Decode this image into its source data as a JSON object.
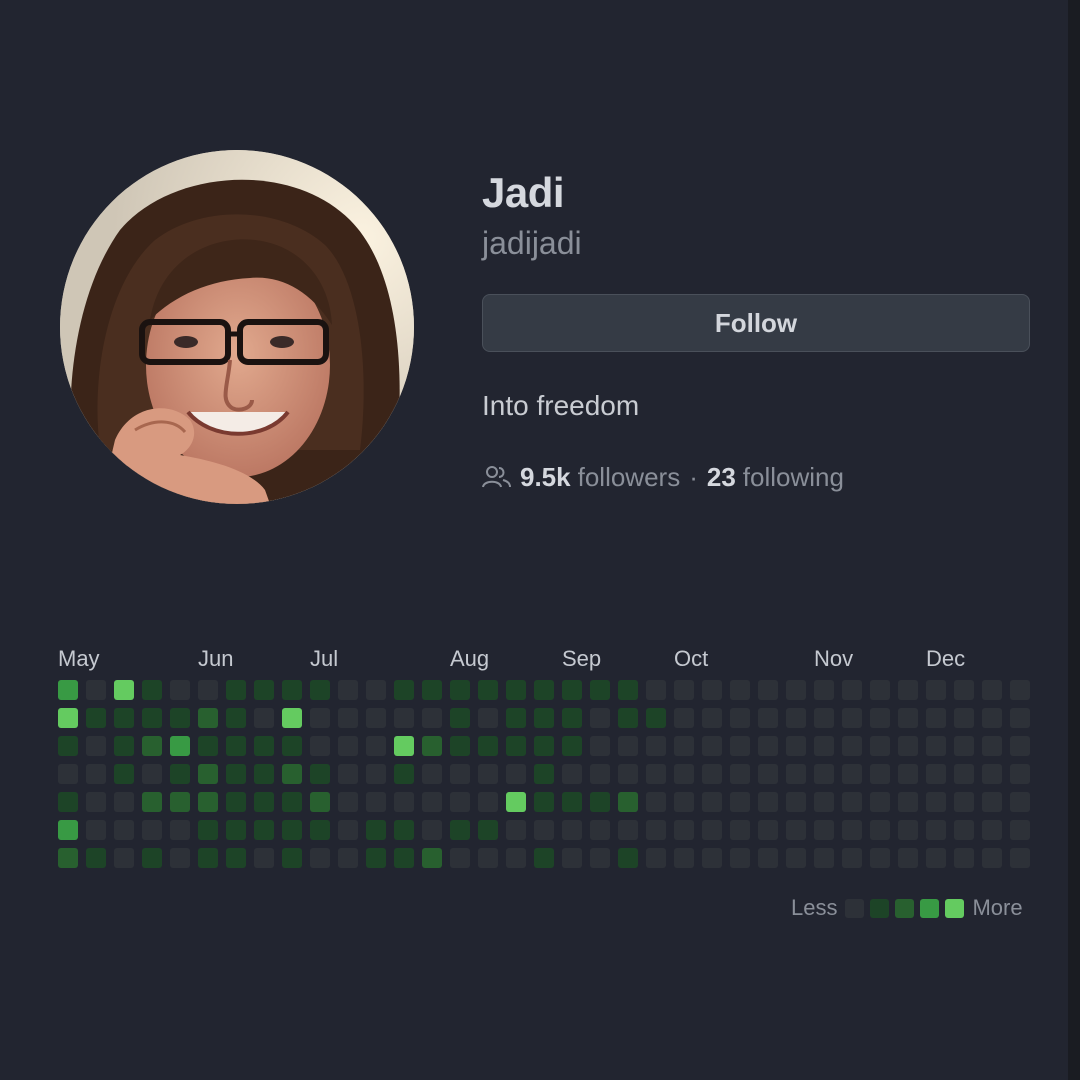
{
  "profile": {
    "name": "Jadi",
    "username": "jadijadi",
    "follow_label": "Follow",
    "bio": "Into freedom",
    "followers_count": "9.5k",
    "followers_label": "followers",
    "separator": "·",
    "following_count": "23",
    "following_label": "following",
    "people_icon": "people-icon"
  },
  "contributions": {
    "months": [
      "May",
      "Jun",
      "Jul",
      "Aug",
      "Sep",
      "Oct",
      "Nov",
      "Dec"
    ],
    "month_week_index": [
      0,
      5,
      9,
      14,
      18,
      22,
      27,
      31
    ],
    "levels_colors": [
      "#2d333b",
      "#0e4429",
      "#006d32",
      "#26a641",
      "#39d353"
    ],
    "render_colors": [
      "#2d3138",
      "#1d4427",
      "#28602f",
      "#389a44",
      "#64cb60"
    ],
    "grid": [
      [
        3,
        0,
        4,
        1,
        0,
        0,
        1,
        1,
        1,
        1,
        0,
        0,
        1,
        1,
        1,
        1,
        1,
        1,
        1,
        1,
        1,
        0,
        0,
        0,
        0,
        0,
        0,
        0,
        0,
        0,
        0,
        0,
        0,
        0,
        0
      ],
      [
        4,
        1,
        1,
        1,
        1,
        2,
        1,
        0,
        4,
        0,
        0,
        0,
        0,
        0,
        1,
        0,
        1,
        1,
        1,
        0,
        1,
        1,
        0,
        0,
        0,
        0,
        0,
        0,
        0,
        0,
        0,
        0,
        0,
        0,
        0
      ],
      [
        1,
        0,
        1,
        2,
        3,
        1,
        1,
        1,
        1,
        0,
        0,
        0,
        4,
        2,
        1,
        1,
        1,
        1,
        1,
        0,
        0,
        0,
        0,
        0,
        0,
        0,
        0,
        0,
        0,
        0,
        0,
        0,
        0,
        0,
        0
      ],
      [
        0,
        0,
        1,
        0,
        1,
        2,
        1,
        1,
        2,
        1,
        0,
        0,
        1,
        0,
        0,
        0,
        0,
        1,
        0,
        0,
        0,
        0,
        0,
        0,
        0,
        0,
        0,
        0,
        0,
        0,
        0,
        0,
        0,
        0,
        0
      ],
      [
        1,
        0,
        0,
        2,
        2,
        2,
        1,
        1,
        1,
        2,
        0,
        0,
        0,
        0,
        0,
        0,
        4,
        1,
        1,
        1,
        2,
        0,
        0,
        0,
        0,
        0,
        0,
        0,
        0,
        0,
        0,
        0,
        0,
        0,
        0
      ],
      [
        3,
        0,
        0,
        0,
        0,
        1,
        1,
        1,
        1,
        1,
        0,
        1,
        1,
        0,
        1,
        1,
        0,
        0,
        0,
        0,
        0,
        0,
        0,
        0,
        0,
        0,
        0,
        0,
        0,
        0,
        0,
        0,
        0,
        0,
        0
      ],
      [
        2,
        1,
        0,
        1,
        0,
        1,
        1,
        0,
        1,
        0,
        0,
        1,
        1,
        2,
        0,
        0,
        0,
        1,
        0,
        0,
        1,
        0,
        0,
        0,
        0,
        0,
        0,
        0,
        0,
        0,
        0,
        0,
        0,
        0,
        0
      ]
    ],
    "legend_less": "Less",
    "legend_more": "More"
  }
}
